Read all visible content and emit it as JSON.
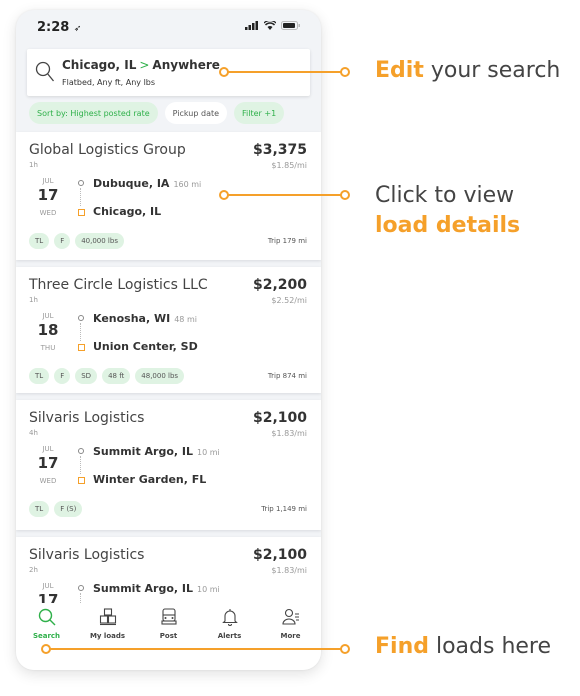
{
  "status_bar": {
    "time": "2:28",
    "location_icon": "location-arrow-icon",
    "signal_icon": "signal-icon",
    "wifi_icon": "wifi-icon",
    "battery_icon": "battery-icon"
  },
  "search": {
    "icon": "search-icon",
    "origin": "Chicago, IL",
    "separator": ">",
    "destination": "Anywhere",
    "criteria": "Flatbed, Any ft, Any lbs"
  },
  "chips": [
    {
      "label": "Sort by: Highest posted rate",
      "active": true
    },
    {
      "label": "Pickup date",
      "active": false
    },
    {
      "label": "Filter +1",
      "active": true
    }
  ],
  "loads": [
    {
      "company": "Global Logistics Group",
      "age": "1h",
      "price": "$3,375",
      "rate": "$1.85/mi",
      "month": "JUL",
      "day": "17",
      "weekday": "WED",
      "origin": "Dubuque, IA",
      "deadhead": "160 mi",
      "destination": "Chicago, IL",
      "tags": [
        "TL",
        "F",
        "40,000 lbs"
      ],
      "trip": "Trip 179 mi"
    },
    {
      "company": "Three Circle Logistics LLC",
      "age": "1h",
      "price": "$2,200",
      "rate": "$2.52/mi",
      "month": "JUL",
      "day": "18",
      "weekday": "THU",
      "origin": "Kenosha, WI",
      "deadhead": "48 mi",
      "destination": "Union Center, SD",
      "tags": [
        "TL",
        "F",
        "SD",
        "48 ft",
        "48,000 lbs"
      ],
      "trip": "Trip 874 mi"
    },
    {
      "company": "Silvaris Logistics",
      "age": "4h",
      "price": "$2,100",
      "rate": "$1.83/mi",
      "month": "JUL",
      "day": "17",
      "weekday": "WED",
      "origin": "Summit Argo, IL",
      "deadhead": "10 mi",
      "destination": "Winter Garden, FL",
      "tags": [
        "TL",
        "F (S)"
      ],
      "trip": "Trip 1,149 mi"
    },
    {
      "company": "Silvaris Logistics",
      "age": "2h",
      "price": "$2,100",
      "rate": "$1.83/mi",
      "month": "JUL",
      "day": "17",
      "weekday": "",
      "origin": "Summit Argo, IL",
      "deadhead": "10 mi",
      "destination": "",
      "tags": [],
      "trip": ""
    }
  ],
  "bottom_nav": [
    {
      "label": "Search",
      "icon": "search-icon",
      "active": true
    },
    {
      "label": "My loads",
      "icon": "boxes-icon",
      "active": false
    },
    {
      "label": "Post",
      "icon": "truck-icon",
      "active": false
    },
    {
      "label": "Alerts",
      "icon": "bell-icon",
      "active": false
    },
    {
      "label": "More",
      "icon": "user-menu-icon",
      "active": false
    }
  ],
  "callouts": {
    "edit": {
      "highlight": "Edit",
      "rest": " your search"
    },
    "details": {
      "line1": "Click to view",
      "highlight": "load details"
    },
    "find": {
      "highlight": "Find",
      "rest": " loads here"
    }
  },
  "colors": {
    "accent_green": "#2fb04a",
    "callout_orange": "#f5a02a",
    "chip_green_bg": "#dff3e3"
  }
}
